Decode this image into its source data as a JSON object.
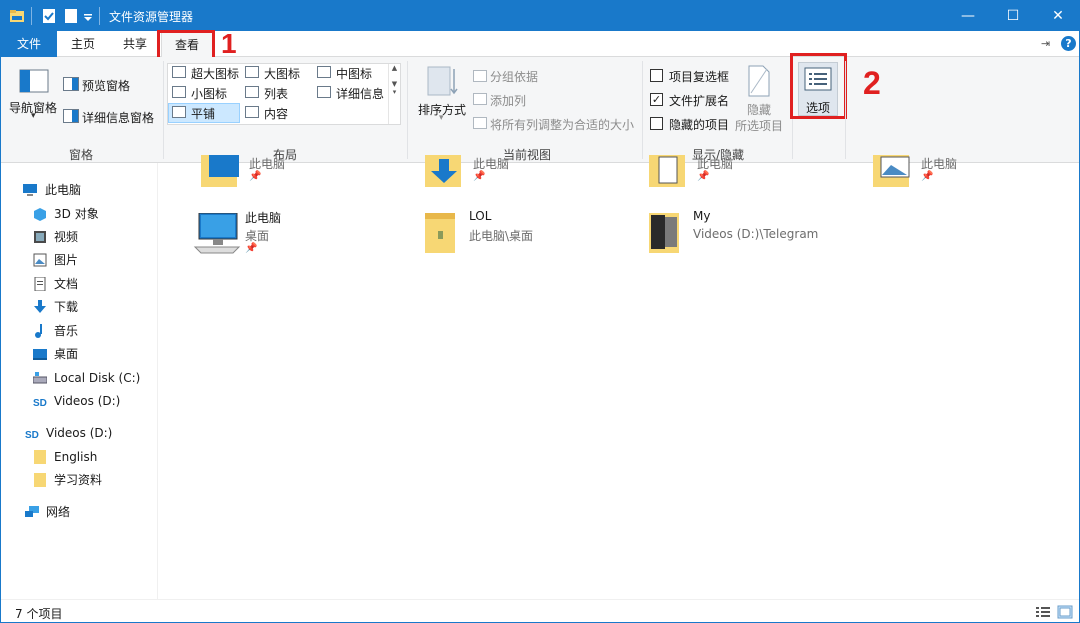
{
  "window": {
    "title": "文件资源管理器",
    "minimize": "—",
    "maximize": "☐",
    "close": "✕",
    "accent": "#1979ca"
  },
  "tabs": {
    "file": "文件",
    "home": "主页",
    "share": "共享",
    "view": "查看"
  },
  "annotations": {
    "step1": "1",
    "step2": "2",
    "color": "#e02020"
  },
  "ribbon": {
    "panes": {
      "group_label": "窗格",
      "nav_pane": "导航窗格",
      "preview_pane": "预览窗格",
      "details_pane": "详细信息窗格"
    },
    "layout": {
      "group_label": "布局",
      "items": [
        "超大图标",
        "大图标",
        "中图标",
        "小图标",
        "列表",
        "详细信息",
        "平铺",
        "内容"
      ],
      "selected": "平铺"
    },
    "current_view": {
      "group_label": "当前视图",
      "sort_by": "排序方式",
      "group_by": "分组依据",
      "add_columns": "添加列",
      "size_all_columns": "将所有列调整为合适的大小"
    },
    "show_hide": {
      "group_label": "显示/隐藏",
      "item_check_boxes": "项目复选框",
      "item_check_boxes_checked": false,
      "file_extensions": "文件扩展名",
      "file_extensions_checked": true,
      "hidden_items": "隐藏的项目",
      "hidden_items_checked": false,
      "hide_selected_1": "隐藏",
      "hide_selected_2": "所选项目"
    },
    "options": {
      "label": "选项"
    }
  },
  "nav": {
    "this_pc": "此电脑",
    "items": [
      "3D 对象",
      "视频",
      "图片",
      "文档",
      "下载",
      "音乐",
      "桌面",
      "Local Disk (C:)",
      "Videos (D:)"
    ],
    "videos_drive": "Videos (D:)",
    "videos_children": [
      "English",
      "学习资料"
    ],
    "network": "网络"
  },
  "quick_access": {
    "top_row": [
      {
        "path": "此电脑",
        "pin": "📌"
      },
      {
        "path": "此电脑",
        "pin": "📌"
      },
      {
        "path": "此电脑",
        "pin": "📌"
      },
      {
        "path": "此电脑",
        "pin": "📌"
      }
    ],
    "items": [
      {
        "name": "此电脑",
        "path": "桌面",
        "pin": "📌"
      },
      {
        "name": "LOL",
        "path": "此电脑\\桌面",
        "pin": ""
      },
      {
        "name": "My",
        "path": "Videos (D:)\\Telegram",
        "pin": ""
      }
    ]
  },
  "status": {
    "item_count": "7 个项目"
  }
}
